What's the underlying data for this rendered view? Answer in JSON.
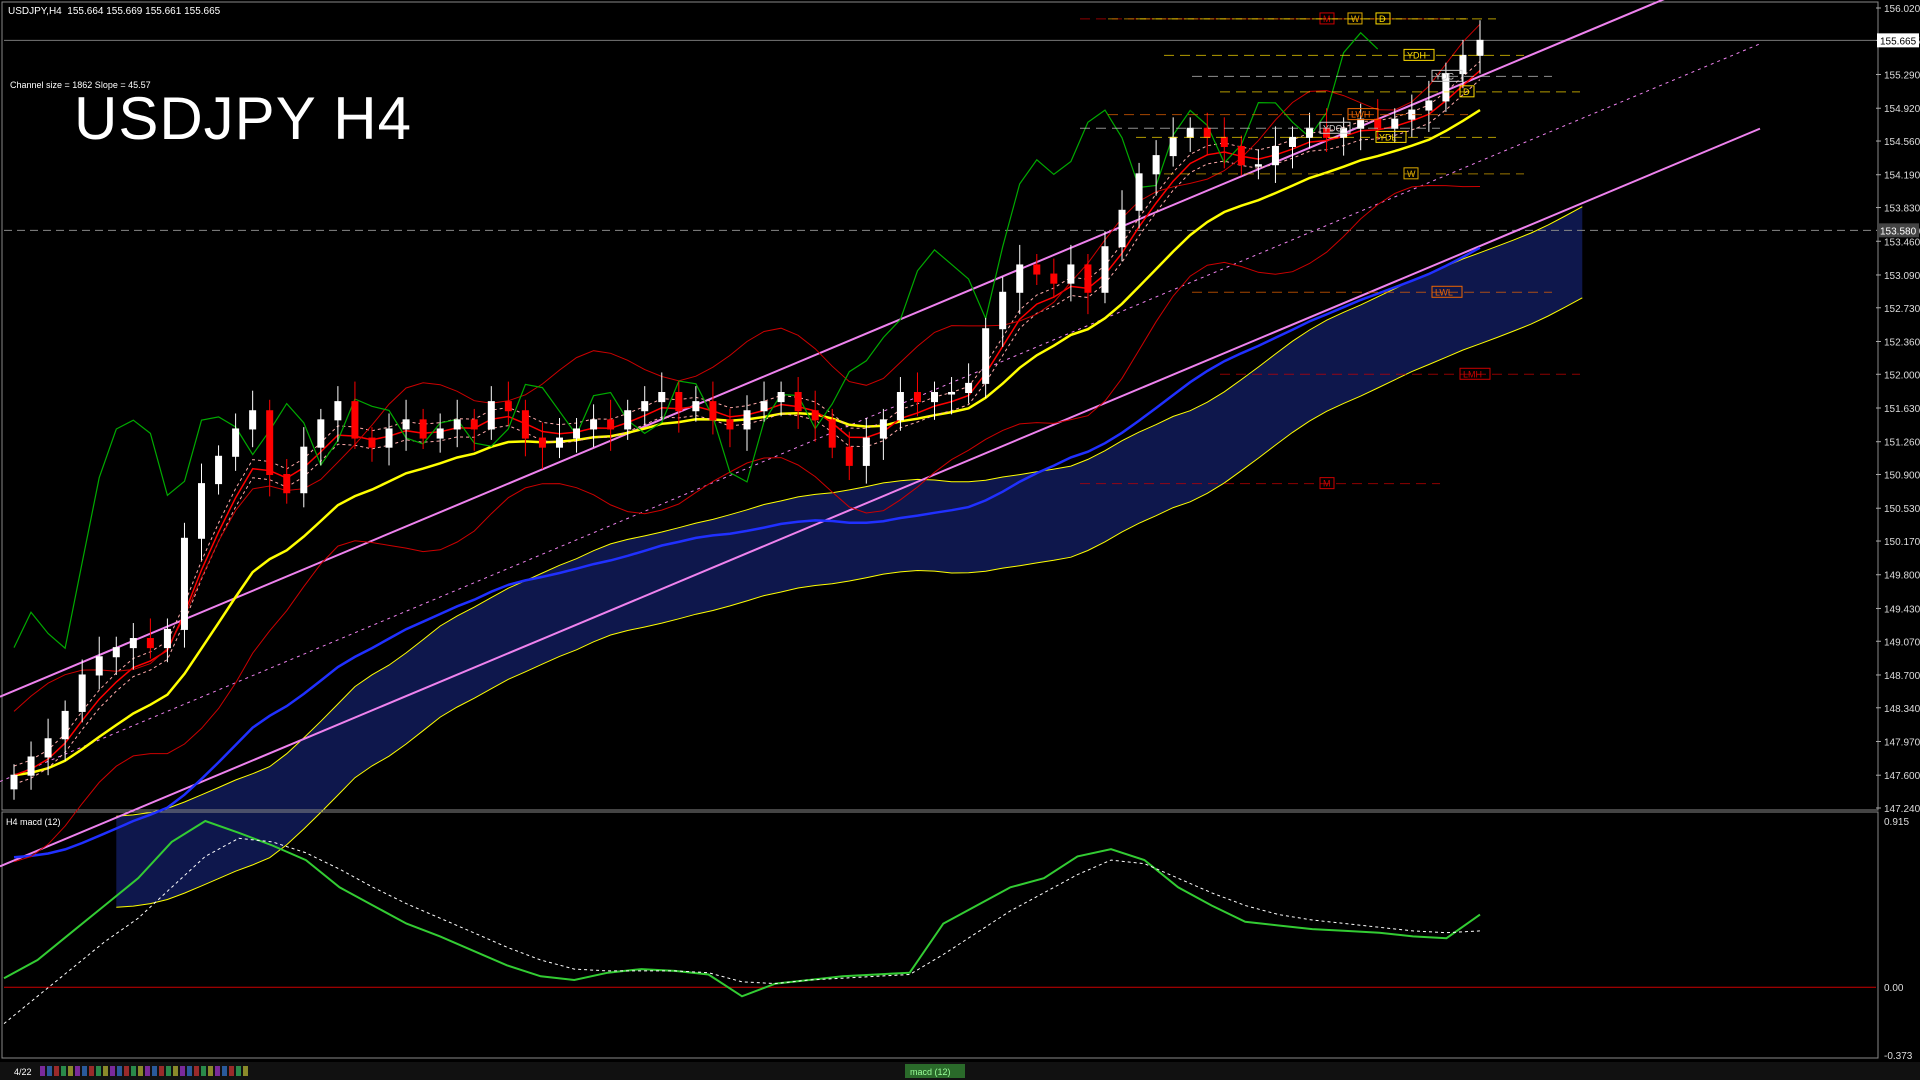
{
  "header": {
    "symbol_line": "USDJPY,H4",
    "quote": "155.664 155.669 155.661 155.665"
  },
  "overlay": {
    "title": "USDJPY H4",
    "channel_info": "Channel size = 1862 Slope = 45.57"
  },
  "macd_panel": {
    "label": "H4 macd (12)",
    "tab_label": "macd (12)",
    "bottom_left_date": "4/22"
  },
  "colors": {
    "background": "#000000",
    "bull_candle": "#ffffff",
    "bear_candle": "#ff0000",
    "channel": "#ee82ee",
    "ema_slow": "#2030ff",
    "ema_mid": "#ffff00",
    "macd_line": "#33cc33",
    "signal_line": "#ffffff",
    "ichimoku_lag": "#00aa00",
    "bollinger": "#cc0000",
    "cloud_bull": "#1a2a8a",
    "cloud_bear": "#8a1a1a"
  },
  "chart_data": [
    {
      "type": "candlestick",
      "title": "USDJPY H4",
      "y_ticks": [
        "156.020",
        "155.665",
        "155.290",
        "154.920",
        "154.560",
        "154.190",
        "153.830",
        "153.580",
        "153.460",
        "153.090",
        "152.730",
        "152.360",
        "152.000",
        "151.630",
        "151.260",
        "150.900",
        "150.530",
        "150.170",
        "149.800",
        "149.430",
        "149.070",
        "148.700",
        "148.340",
        "147.970",
        "147.600",
        "147.240"
      ],
      "current_price": "155.665",
      "dashed_level": "153.580",
      "ylim": [
        147.24,
        156.02
      ],
      "levels": [
        {
          "label": "M",
          "price": 155.9
        },
        {
          "label": "W",
          "price": 155.9
        },
        {
          "label": "D",
          "price": 155.9
        },
        {
          "label": "YDH",
          "price": 155.5
        },
        {
          "label": "YDC",
          "price": 155.27
        },
        {
          "label": "D",
          "price": 155.1
        },
        {
          "label": "YDO",
          "price": 154.7
        },
        {
          "label": "LWH",
          "price": 154.85
        },
        {
          "label": "YDL",
          "price": 154.6
        },
        {
          "label": "W",
          "price": 154.2
        },
        {
          "label": "LWL",
          "price": 152.9
        },
        {
          "label": "LMH",
          "price": 152.0
        },
        {
          "label": "M",
          "price": 150.8
        }
      ],
      "close_series": [
        147.6,
        147.8,
        148.0,
        148.3,
        148.7,
        148.9,
        149.0,
        149.1,
        149.0,
        149.2,
        150.2,
        150.8,
        151.1,
        151.4,
        151.6,
        150.9,
        150.7,
        151.2,
        151.5,
        151.7,
        151.3,
        151.2,
        151.4,
        151.5,
        151.3,
        151.4,
        151.5,
        151.4,
        151.7,
        151.6,
        151.3,
        151.2,
        151.3,
        151.4,
        151.5,
        151.4,
        151.6,
        151.7,
        151.8,
        151.6,
        151.7,
        151.5,
        151.4,
        151.6,
        151.7,
        151.8,
        151.6,
        151.5,
        151.2,
        151.0,
        151.3,
        151.5,
        151.8,
        151.7,
        151.8,
        151.8,
        151.9,
        152.5,
        152.9,
        153.2,
        153.1,
        153.0,
        153.2,
        152.9,
        153.4,
        153.8,
        154.2,
        154.4,
        154.6,
        154.7,
        154.6,
        154.5,
        154.3,
        154.3,
        154.5,
        154.6,
        154.7,
        154.6,
        154.7,
        154.8,
        154.7,
        154.8,
        154.9,
        155.0,
        155.3,
        155.5,
        155.665
      ]
    },
    {
      "type": "line",
      "title": "H4 macd (12)",
      "y_ticks": [
        "0.915",
        "0.00",
        "-0.373"
      ],
      "ylim": [
        -0.373,
        0.915
      ],
      "series": [
        {
          "name": "macd (12)",
          "values": [
            0.05,
            0.15,
            0.3,
            0.45,
            0.6,
            0.8,
            0.915,
            0.85,
            0.78,
            0.7,
            0.55,
            0.45,
            0.35,
            0.28,
            0.2,
            0.12,
            0.06,
            0.04,
            0.08,
            0.1,
            0.09,
            0.07,
            -0.05,
            0.02,
            0.04,
            0.06,
            0.07,
            0.08,
            0.35,
            0.45,
            0.55,
            0.6,
            0.72,
            0.76,
            0.7,
            0.55,
            0.45,
            0.36,
            0.34,
            0.32,
            0.31,
            0.3,
            0.28,
            0.27,
            0.4
          ]
        },
        {
          "values": [
            -0.2,
            -0.05,
            0.1,
            0.25,
            0.38,
            0.55,
            0.72,
            0.82,
            0.8,
            0.74,
            0.65,
            0.55,
            0.46,
            0.38,
            0.3,
            0.22,
            0.15,
            0.1,
            0.09,
            0.09,
            0.09,
            0.08,
            0.03,
            0.02,
            0.04,
            0.05,
            0.06,
            0.07,
            0.18,
            0.3,
            0.42,
            0.52,
            0.62,
            0.7,
            0.68,
            0.6,
            0.52,
            0.45,
            0.4,
            0.37,
            0.35,
            0.33,
            0.31,
            0.3,
            0.31
          ]
        }
      ]
    }
  ]
}
